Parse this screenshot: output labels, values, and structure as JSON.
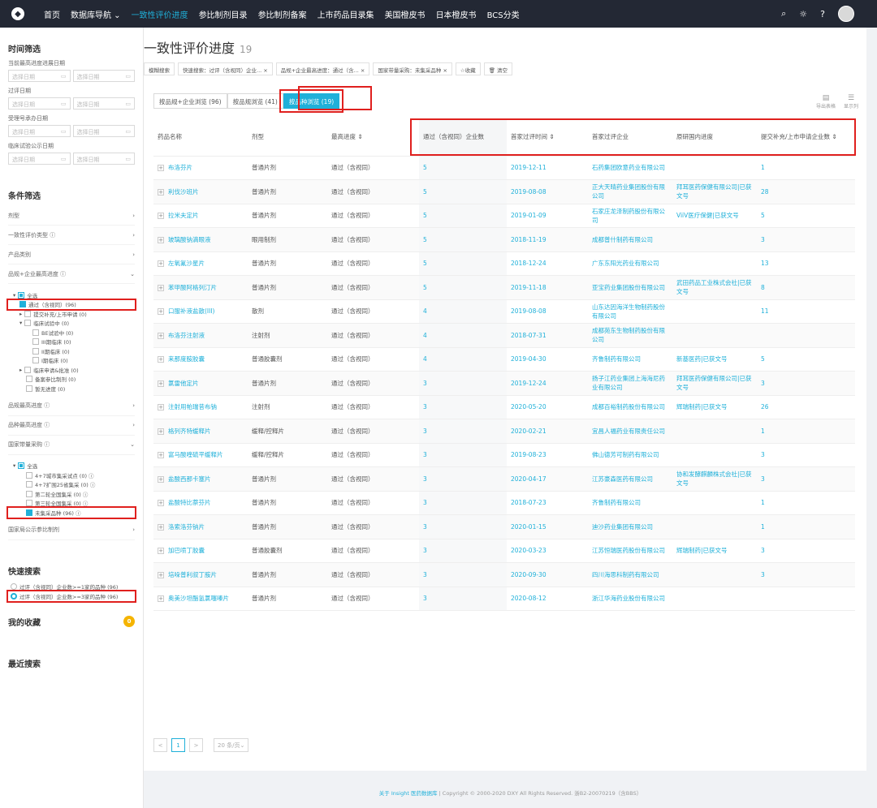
{
  "nav": {
    "items": [
      "首页",
      "数据库导航 ⌄",
      "一致性评价进度",
      "参比制剂目录",
      "参比制剂备案",
      "上市药品目录集",
      "美国橙皮书",
      "日本橙皮书",
      "BCS分类"
    ],
    "active": 2
  },
  "sidebar": {
    "time_title": "时间筛选",
    "date_fields": [
      "当前最高进度进展日期",
      "过评日期",
      "受理号承办日期",
      "临床试验公示日期"
    ],
    "date_placeholder": "选择日期",
    "cond_title": "条件筛选",
    "conds1": [
      "剂型",
      "一致性评价类型 ⓘ",
      "产品类别",
      "品规+企业最高进度 ⓘ"
    ],
    "tree1": [
      "全选",
      "通过（含视同）(96)",
      "提交补充/上市申请 (0)",
      "临床试验中 (0)",
      "BE试验中 (0)",
      "III期临床 (0)",
      "II期临床 (0)",
      "I期临床 (0)",
      "临床申请&批准 (0)",
      "备案参比制剂 (0)",
      "暂无进度 (0)"
    ],
    "conds2": [
      "品规最高进度 ⓘ",
      "品种最高进度 ⓘ",
      "国家带量采购 ⓘ"
    ],
    "tree2": [
      "全选",
      "4+7城市集采试点 (0) ⓘ",
      "4+7扩围25省集采 (0) ⓘ",
      "第二轮全国集采 (0) ⓘ",
      "第三轮全国集采 (0) ⓘ",
      "未集采品种 (96) ⓘ"
    ],
    "cond_last": "国家局公示参比制剂",
    "quick_title": "快速搜索",
    "quick": [
      "过评（含视同）企业数>=1家的品种 (96)",
      "过评（含视同）企业数>=3家的品种 (96)"
    ],
    "fav_title": "我的收藏",
    "fav_count": "0",
    "recent_title": "最近搜索"
  },
  "main": {
    "title": "一致性评价进度",
    "count": "19",
    "tags": [
      "模糊搜索",
      "快速搜索：过评（含视同）企业... ×",
      "品规+企业最高进度：通过（含... ×",
      "国家带量采购：未集采品种 ×",
      "☆收藏",
      "🗑 清空"
    ],
    "tabs": [
      "按品规+企业浏览 (96)",
      "按品规浏览 (41)",
      "按品种浏览 (19)"
    ],
    "tools": [
      "导出表格",
      "显示列"
    ],
    "headers": [
      "药品名称",
      "剂型",
      "最高进度 ⇕",
      "通过（含视同）企业数",
      "首家过评时间 ⇕",
      "首家过评企业",
      "原研国内进度",
      "提交补充/上市申请企业数 ⇕"
    ],
    "rows": [
      [
        "布洛芬片",
        "普通片剂",
        "通过（含视同）",
        "5",
        "2019-12-11",
        "石药集团欧意药业有限公司",
        "",
        "1"
      ],
      [
        "利伐沙班片",
        "普通片剂",
        "通过（含视同）",
        "5",
        "2019-08-08",
        "正大天晴药业集团股份有限公司",
        "拜耳医药保健有限公司|已获文号",
        "28"
      ],
      [
        "拉米夫定片",
        "普通片剂",
        "通过（含视同）",
        "5",
        "2019-01-09",
        "石家庄龙泽制药股份有限公司",
        "ViiV医疗保健|已获文号",
        "5"
      ],
      [
        "玻璃酸钠滴眼液",
        "眼用制剂",
        "通过（含视同）",
        "5",
        "2018-11-19",
        "成都普什制药有限公司",
        "",
        "3"
      ],
      [
        "左氧氟沙星片",
        "普通片剂",
        "通过（含视同）",
        "5",
        "2018-12-24",
        "广东东阳光药业有限公司",
        "",
        "13"
      ],
      [
        "苯甲酸阿格列汀片",
        "普通片剂",
        "通过（含视同）",
        "5",
        "2019-11-18",
        "亚宝药业集团股份有限公司",
        "武田药品工业株式会社|已获文号",
        "8"
      ],
      [
        "口服补液盐散(III)",
        "散剂",
        "通过（含视同）",
        "4",
        "2019-08-08",
        "山东达因海洋生物制药股份有限公司",
        "",
        "11"
      ],
      [
        "布洛芬注射液",
        "注射剂",
        "通过（含视同）",
        "4",
        "2018-07-31",
        "成都苑东生物制药股份有限公司",
        "",
        ""
      ],
      [
        "来那度胺胶囊",
        "普通胶囊剂",
        "通过（含视同）",
        "4",
        "2019-04-30",
        "齐鲁制药有限公司",
        "新基医药|已获文号",
        "5"
      ],
      [
        "氯雷他定片",
        "普通片剂",
        "通过（含视同）",
        "3",
        "2019-12-24",
        "扬子江药业集团上海海尼药业有限公司",
        "拜耳医药保健有限公司|已获文号",
        "3"
      ],
      [
        "注射用帕瑞昔布钠",
        "注射剂",
        "通过（含视同）",
        "3",
        "2020-05-20",
        "成都百裕制药股份有限公司",
        "辉瑞制药|已获文号",
        "26"
      ],
      [
        "格列齐特缓释片",
        "缓释/控释片",
        "通过（含视同）",
        "3",
        "2020-02-21",
        "宜昌人福药业有限责任公司",
        "",
        "1"
      ],
      [
        "富马酸喹硫平缓释片",
        "缓释/控释片",
        "通过（含视同）",
        "3",
        "2019-08-23",
        "佛山德芳可制药有限公司",
        "",
        "3"
      ],
      [
        "盐酸西那卡塞片",
        "普通片剂",
        "通过（含视同）",
        "3",
        "2020-04-17",
        "江苏豪森医药有限公司",
        "协和发酵麒麟株式会社|已获文号",
        "3"
      ],
      [
        "盐酸特比萘芬片",
        "普通片剂",
        "通过（含视同）",
        "3",
        "2018-07-23",
        "齐鲁制药有限公司",
        "",
        "1"
      ],
      [
        "洛索洛芬钠片",
        "普通片剂",
        "通过（含视同）",
        "3",
        "2020-01-15",
        "迪沙药业集团有限公司",
        "",
        "1"
      ],
      [
        "加巴喷丁胶囊",
        "普通胶囊剂",
        "通过（含视同）",
        "3",
        "2020-03-23",
        "江苏恒瑞医药股份有限公司",
        "辉瑞制药|已获文号",
        "3"
      ],
      [
        "培哚普利叔丁胺片",
        "普通片剂",
        "通过（含视同）",
        "3",
        "2020-09-30",
        "四川海思科制药有限公司",
        "",
        "3"
      ],
      [
        "奥美沙坦酯氢氯噻嗪片",
        "普通片剂",
        "通过（含视同）",
        "3",
        "2020-08-12",
        "浙江华海药业股份有限公司",
        "",
        ""
      ]
    ],
    "pager": {
      "prev": "<",
      "page": "1",
      "next": ">",
      "size": "20 条/页⌄"
    }
  },
  "footer": {
    "link": "关于 Insight 医药数据库",
    "text": " | Copyright © 2000-2020 DXY All Rights Reserved. 浙B2-20070219（含BBS）"
  }
}
